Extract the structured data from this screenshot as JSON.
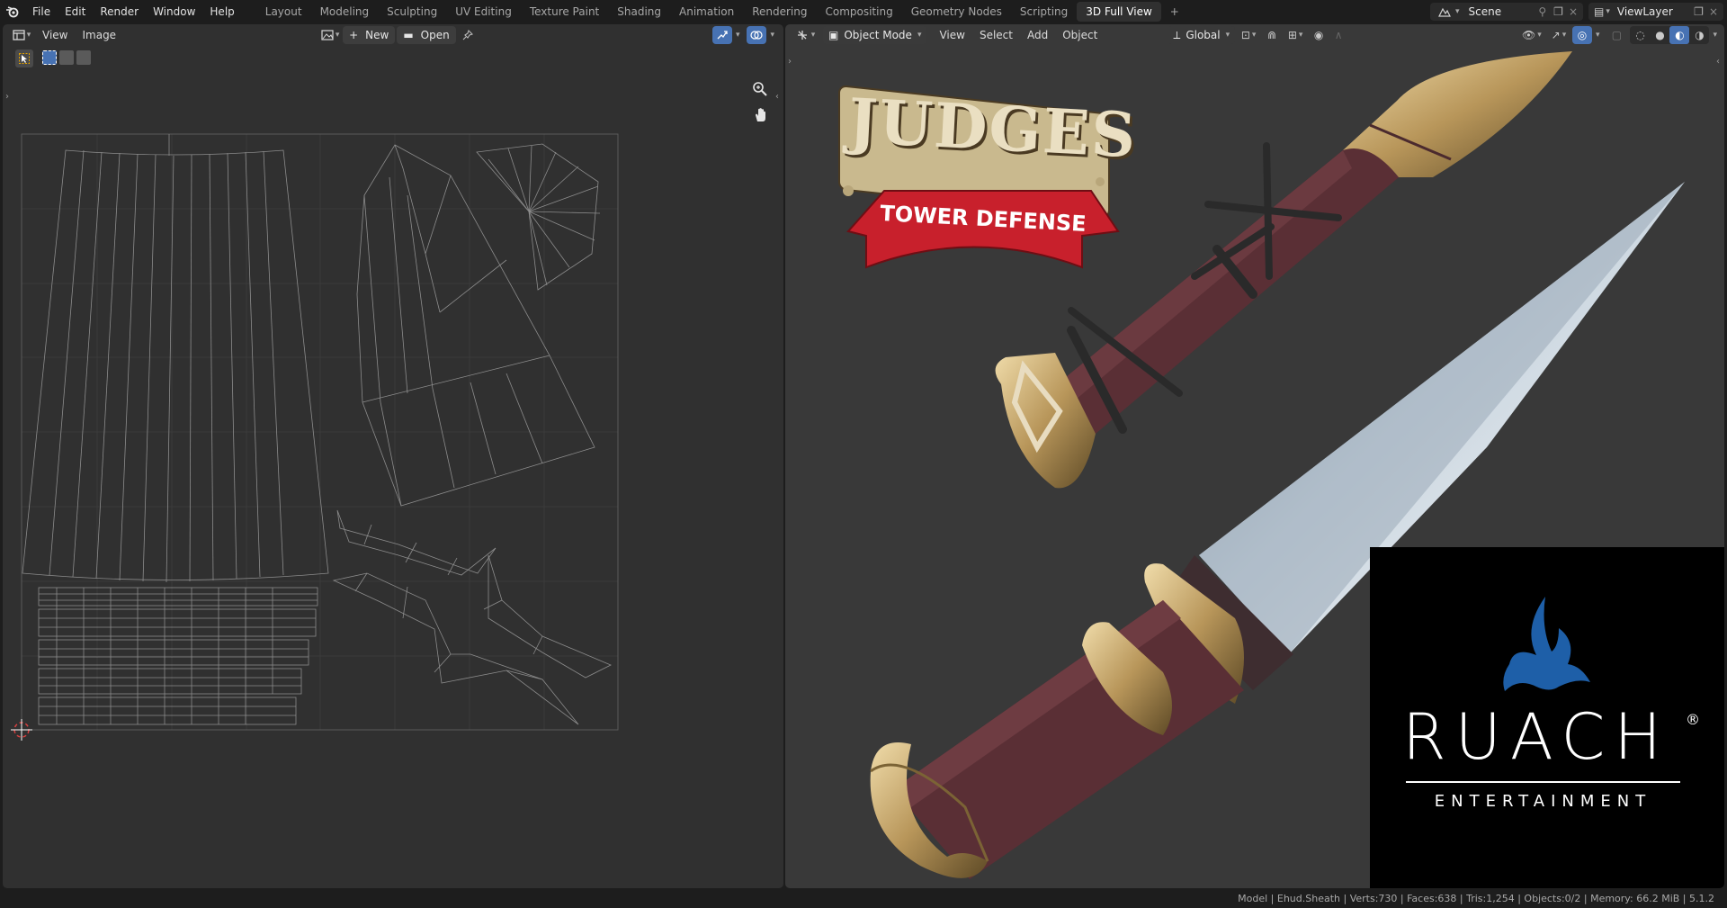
{
  "topbar": {
    "menus": [
      "File",
      "Edit",
      "Render",
      "Window",
      "Help"
    ],
    "workspaces": [
      "Layout",
      "Modeling",
      "Sculpting",
      "UV Editing",
      "Texture Paint",
      "Shading",
      "Animation",
      "Rendering",
      "Compositing",
      "Geometry Nodes",
      "Scripting",
      "3D Full View"
    ],
    "active_workspace": "3D Full View",
    "add_workspace_label": "+",
    "scene": "Scene",
    "view_layer": "ViewLayer"
  },
  "uv_editor": {
    "menus": [
      "View",
      "Image"
    ],
    "new_label": "New",
    "open_label": "Open"
  },
  "viewport": {
    "mode": "Object Mode",
    "menus": [
      "View",
      "Select",
      "Add",
      "Object"
    ],
    "transform_orientation": "Global"
  },
  "overlay": {
    "game_logo_title": "JUDGES",
    "game_logo_banner": "TOWER DEFENSE",
    "brand_name": "RUACH",
    "brand_registered": "®",
    "brand_sub": "ENTERTAINMENT"
  },
  "statusbar": {
    "text": "Model | Ehud.Sheath | Verts:730 | Faces:638 | Tris:1,254 | Objects:0/2 | Memory: 66.2 MiB | 5.1.2"
  },
  "colors": {
    "accent": "#4772b3",
    "sheath": "#5a2f35",
    "gold": "#b8965a",
    "banner": "#c8202c",
    "flame": "#1e5fa8"
  }
}
